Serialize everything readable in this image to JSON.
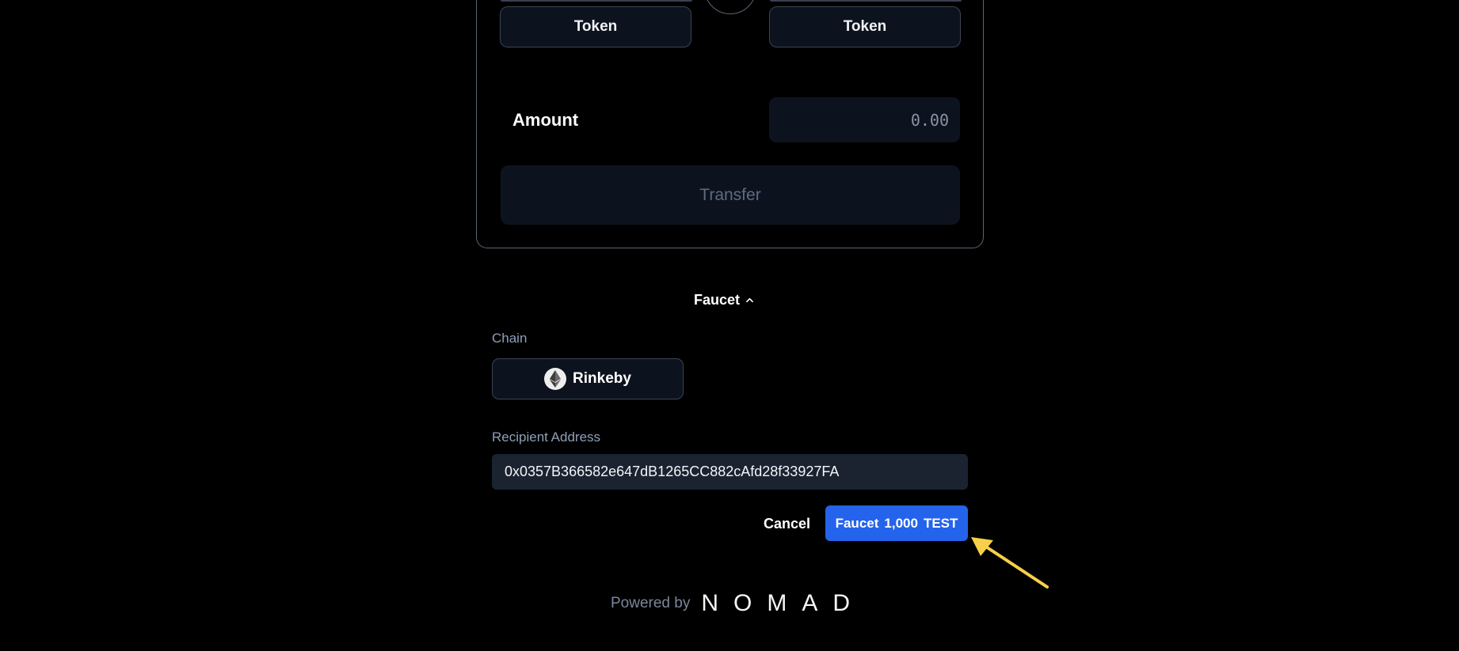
{
  "transfer_card": {
    "from_token_label": "Token",
    "to_token_label": "Token",
    "amount_label": "Amount",
    "amount_placeholder": "0.00",
    "transfer_button_label": "Transfer"
  },
  "faucet": {
    "toggle_label": "Faucet",
    "chain_label": "Chain",
    "chain_selected": "Rinkeby",
    "recipient_label": "Recipient Address",
    "recipient_value": "0x0357B366582e647dB1265CC882cAfd28f33927FA",
    "cancel_label": "Cancel",
    "faucet_button": {
      "prefix": "Faucet",
      "amount": "1,000",
      "token": "TEST"
    }
  },
  "footer": {
    "powered_by": "Powered by",
    "brand": "NOMAD"
  },
  "colors": {
    "background": "#000000",
    "primary": "#2463eb",
    "annotation_arrow": "#f7d04a"
  },
  "icons": {
    "chain_icon": "ethereum-icon",
    "toggle_icon": "chevron-up-icon"
  }
}
